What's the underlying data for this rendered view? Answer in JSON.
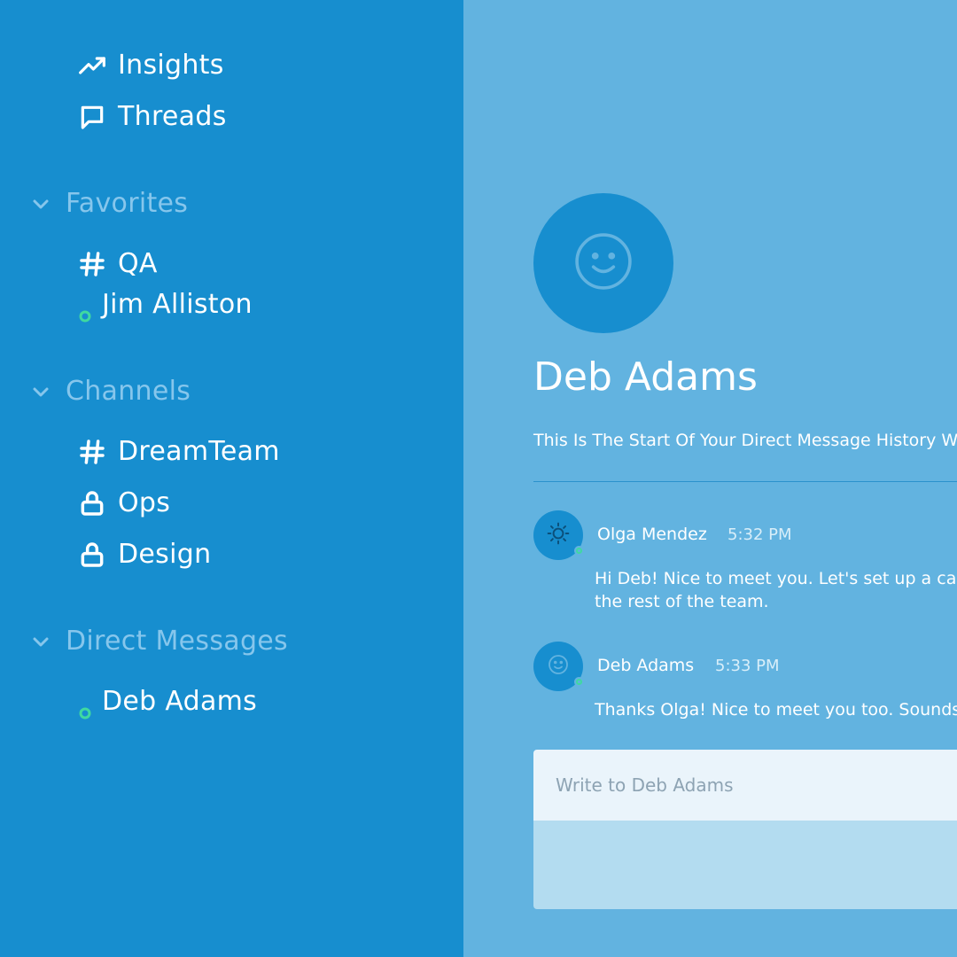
{
  "sidebar": {
    "top_items": [
      {
        "label": "Insights",
        "icon": "trending-up-icon"
      },
      {
        "label": "Threads",
        "icon": "chat-bubble-icon"
      }
    ],
    "favorites": {
      "title": "Favorites",
      "items": [
        {
          "label": "QA",
          "icon": "hash-icon"
        },
        {
          "label": "Jim Alliston",
          "icon": "online-status-icon"
        }
      ]
    },
    "channels": {
      "title": "Channels",
      "items": [
        {
          "label": "DreamTeam",
          "icon": "hash-icon"
        },
        {
          "label": "Ops",
          "icon": "lock-icon"
        },
        {
          "label": "Design",
          "icon": "lock-icon"
        }
      ]
    },
    "direct_messages": {
      "title": "Direct Messages",
      "items": [
        {
          "label": "Deb Adams",
          "icon": "online-status-icon"
        }
      ]
    }
  },
  "profile": {
    "name": "Deb Adams",
    "history_note": "This Is The Start Of Your Direct Message History With Deb Adams"
  },
  "messages": [
    {
      "author": "Olga Mendez",
      "time": "5:32 PM",
      "avatar_icon": "sun-icon",
      "lines": [
        "Hi Deb! Nice to meet you. Let's set up a call with",
        "the rest of the team."
      ]
    },
    {
      "author": "Deb Adams",
      "time": "5:33 PM",
      "avatar_icon": "smiley-icon",
      "lines": [
        "Thanks Olga! Nice to meet you too. Sounds great."
      ]
    }
  ],
  "composer": {
    "placeholder": "Write to Deb Adams"
  },
  "colors": {
    "sidebar_bg": "#178ecf",
    "main_bg": "#62b3e0",
    "section_title": "#86c6ec",
    "online": "#3fd9a0",
    "composer_input_bg": "#eaf4fb",
    "composer_area_bg": "#b3dcf0"
  }
}
